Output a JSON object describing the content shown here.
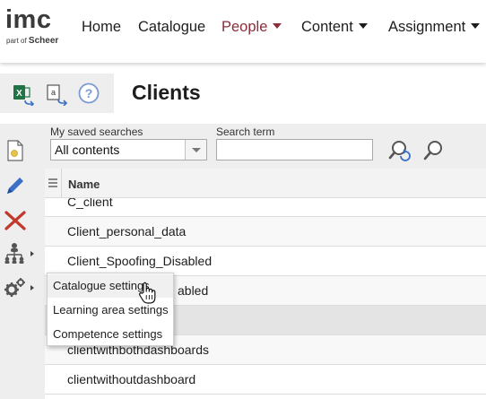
{
  "logo": {
    "brand": "imc",
    "tagline_prefix": "part of",
    "tagline_brand": "Scheer"
  },
  "nav": {
    "home": "Home",
    "catalogue": "Catalogue",
    "people": "People",
    "content": "Content",
    "assignment": "Assignment"
  },
  "colors": {
    "accent": "#8b2d3a",
    "excel_icon": "#217346",
    "help_icon": "#7c9ad1",
    "delete_icon": "#c0392b",
    "edit_icon": "#3b6fc8"
  },
  "toolbar": {
    "icons": [
      "excel-export-icon",
      "text-export-icon",
      "help-icon"
    ]
  },
  "page": {
    "title": "Clients"
  },
  "side": {
    "icons": [
      "new-document-icon",
      "edit-pencil-icon",
      "delete-x-icon",
      "org-hierarchy-icon",
      "settings-gears-icon"
    ]
  },
  "search": {
    "saved_label": "My saved searches",
    "saved_value": "All contents",
    "term_label": "Search term",
    "term_value": "",
    "term_placeholder": ""
  },
  "table": {
    "header_name": "Name",
    "rows": [
      {
        "name": "C_client"
      },
      {
        "name": "Client_personal_data"
      },
      {
        "name": "Client_Spoofing_Disabled"
      },
      {
        "name": "abled"
      },
      {
        "name": ""
      },
      {
        "name": "clientwithbothdashboards"
      },
      {
        "name": "clientwithoutdashboard"
      }
    ]
  },
  "menu": {
    "items": [
      "Catalogue settings",
      "Learning area settings",
      "Competence settings"
    ]
  }
}
